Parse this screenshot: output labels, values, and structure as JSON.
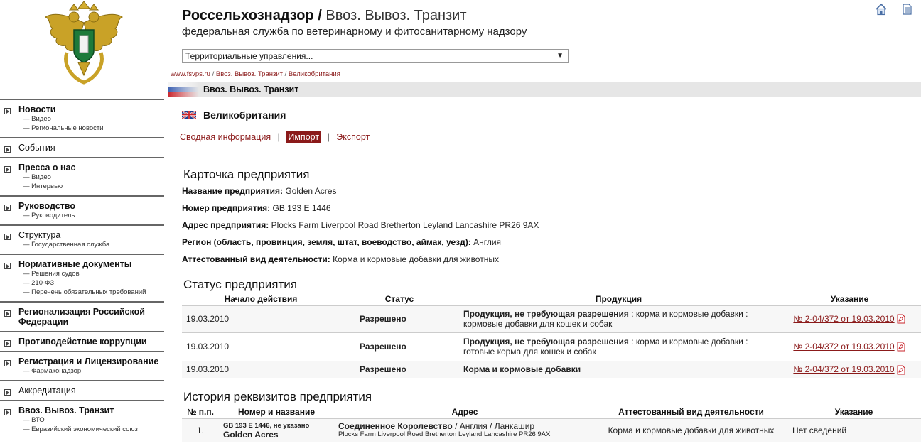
{
  "header": {
    "brand": "Россельхознадзор",
    "separator": "/",
    "section": "Ввоз. Вывоз. Транзит",
    "subtitle": "федеральная служба по ветеринарному и фитосанитарному надзору",
    "region_select": "Территориальные управления...",
    "home_icon": "home-icon",
    "doc_icon": "document-icon"
  },
  "breadcrumb": [
    "www.fsvps.ru",
    "Ввоз. Вывоз. Транзит",
    "Великобритания"
  ],
  "section_bar": {
    "title": "Ввоз. Вывоз. Транзит"
  },
  "country": {
    "name": "Великобритания"
  },
  "tabs": [
    {
      "label": "Сводная информация",
      "active": false
    },
    {
      "label": "Импорт",
      "active": true
    },
    {
      "label": "Экспорт",
      "active": false
    }
  ],
  "nav": [
    {
      "label": "Новости",
      "bold": true,
      "subs": [
        "— Видео",
        "— Региональные новости"
      ]
    },
    {
      "label": "События",
      "bold": false,
      "subs": []
    },
    {
      "label": "Пресса о нас",
      "bold": true,
      "subs": [
        "— Видео",
        "— Интервью"
      ]
    },
    {
      "label": "Руководство",
      "bold": true,
      "subs": [
        "— Руководитель"
      ]
    },
    {
      "label": "Структура",
      "bold": false,
      "subs": [
        "— Государственная служба"
      ]
    },
    {
      "label": "Нормативные документы",
      "bold": true,
      "subs": [
        "— Решения судов",
        "— 210-ФЗ",
        "— Перечень обязательных требований"
      ]
    },
    {
      "label": "Регионализация Российской Федерации",
      "bold": true,
      "subs": []
    },
    {
      "label": "Противодействие коррупции",
      "bold": true,
      "subs": []
    },
    {
      "label": "Регистрация и Лицензирование",
      "bold": true,
      "subs": [
        "— Фармаконадзор"
      ]
    },
    {
      "label": "Аккредитация",
      "bold": false,
      "subs": []
    },
    {
      "label": "Ввоз. Вывоз. Транзит",
      "bold": true,
      "subs": [
        "— ВТО",
        "— Евразийский экономический союз"
      ]
    }
  ],
  "card": {
    "title": "Карточка предприятия",
    "name_label": "Название предприятия:",
    "name_value": "Golden Acres",
    "number_label": "Номер предприятия:",
    "number_value": "GB 193 E 1446",
    "address_label": "Адрес предприятия:",
    "address_value": "Plocks Farm Liverpool Road Bretherton Leyland Lancashire PR26 9AX",
    "region_label": "Регион (область, провинция, земля, штат, воеводство, аймак, уезд):",
    "region_value": "Англия",
    "activity_label": "Аттестованный вид деятельности:",
    "activity_value": "Корма и кормовые добавки для животных"
  },
  "status": {
    "title": "Статус предприятия",
    "headers": [
      "Начало действия",
      "Статус",
      "Продукция",
      "Указание"
    ],
    "rows": [
      {
        "date": "19.03.2010",
        "status": "Разрешено",
        "product_bold": "Продукция, не требующая разрешения",
        "product_rest": " : корма и кормовые добавки : кормовые добавки для кошек и собак",
        "doc": "№ 2-04/372 от 19.03.2010"
      },
      {
        "date": "19.03.2010",
        "status": "Разрешено",
        "product_bold": "Продукция, не требующая разрешения",
        "product_rest": " : корма и кормовые добавки : готовые корма для кошек и собак",
        "doc": "№ 2-04/372 от 19.03.2010"
      },
      {
        "date": "19.03.2010",
        "status": "Разрешено",
        "product_bold": "Корма и кормовые добавки",
        "product_rest": "",
        "doc": "№ 2-04/372 от 19.03.2010"
      }
    ]
  },
  "history": {
    "title": "История реквизитов предприятия",
    "headers": [
      "№ п.п.",
      "Номер и название",
      "Адрес",
      "Аттестованный вид деятельности",
      "Указание"
    ],
    "rows": [
      {
        "num": "1.",
        "number_line": "GB 193 E 1446, не указано",
        "name": "Golden Acres",
        "country": "Соединенное Королевство",
        "region": " / Англия / Ланкашир",
        "address": "Plocks Farm Liverpool Road Bretherton Leyland Lancashire PR26 9AX",
        "activity": "Корма и кормовые добавки для животных",
        "note": "Нет сведений"
      }
    ]
  }
}
